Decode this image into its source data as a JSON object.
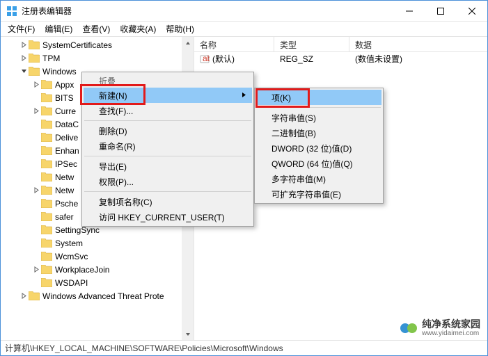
{
  "title": "注册表编辑器",
  "menubar": [
    "文件(F)",
    "编辑(E)",
    "查看(V)",
    "收藏夹(A)",
    "帮助(H)"
  ],
  "tree": {
    "items": [
      {
        "indent": 1,
        "twisty": ">",
        "label": "SystemCertificates"
      },
      {
        "indent": 1,
        "twisty": ">",
        "label": "TPM"
      },
      {
        "indent": 1,
        "twisty": "v",
        "label": "Windows"
      },
      {
        "indent": 2,
        "twisty": ">",
        "label": "Appx"
      },
      {
        "indent": 2,
        "twisty": "",
        "label": "BITS"
      },
      {
        "indent": 2,
        "twisty": ">",
        "label": "Curre"
      },
      {
        "indent": 2,
        "twisty": "",
        "label": "DataC"
      },
      {
        "indent": 2,
        "twisty": "",
        "label": "Delive"
      },
      {
        "indent": 2,
        "twisty": "",
        "label": "Enhan"
      },
      {
        "indent": 2,
        "twisty": "",
        "label": "IPSec"
      },
      {
        "indent": 2,
        "twisty": "",
        "label": "Netw"
      },
      {
        "indent": 2,
        "twisty": ">",
        "label": "Netw"
      },
      {
        "indent": 2,
        "twisty": "",
        "label": "Psche"
      },
      {
        "indent": 2,
        "twisty": "",
        "label": "safer"
      },
      {
        "indent": 2,
        "twisty": "",
        "label": "SettingSync"
      },
      {
        "indent": 2,
        "twisty": "",
        "label": "System"
      },
      {
        "indent": 2,
        "twisty": "",
        "label": "WcmSvc"
      },
      {
        "indent": 2,
        "twisty": ">",
        "label": "WorkplaceJoin"
      },
      {
        "indent": 2,
        "twisty": "",
        "label": "WSDAPI"
      },
      {
        "indent": 1,
        "twisty": ">",
        "label": "Windows Advanced Threat Prote"
      }
    ]
  },
  "list": {
    "columns": {
      "name": "名称",
      "type": "类型",
      "data": "数据"
    },
    "rows": [
      {
        "name": "(默认)",
        "type": "REG_SZ",
        "data": "(数值未设置)"
      }
    ]
  },
  "statusbar": "计算机\\HKEY_LOCAL_MACHINE\\SOFTWARE\\Policies\\Microsoft\\Windows",
  "context_menu": {
    "header": "折叠",
    "items": [
      {
        "label": "新建(N)",
        "submenu": true,
        "highlighted": true
      },
      {
        "label": "查找(F)..."
      },
      {
        "sep": true
      },
      {
        "label": "删除(D)"
      },
      {
        "label": "重命名(R)"
      },
      {
        "sep": true
      },
      {
        "label": "导出(E)"
      },
      {
        "label": "权限(P)..."
      },
      {
        "sep": true
      },
      {
        "label": "复制项名称(C)"
      },
      {
        "label": "访问 HKEY_CURRENT_USER(T)"
      }
    ]
  },
  "submenu": {
    "items": [
      {
        "label": "项(K)",
        "highlighted": true
      },
      {
        "sep": true
      },
      {
        "label": "字符串值(S)"
      },
      {
        "label": "二进制值(B)"
      },
      {
        "label": "DWORD (32 位)值(D)"
      },
      {
        "label": "QWORD (64 位)值(Q)"
      },
      {
        "label": "多字符串值(M)"
      },
      {
        "label": "可扩充字符串值(E)"
      }
    ]
  },
  "watermark": {
    "line1": "纯净系统家园",
    "line2": "www.yidaimei.com"
  }
}
